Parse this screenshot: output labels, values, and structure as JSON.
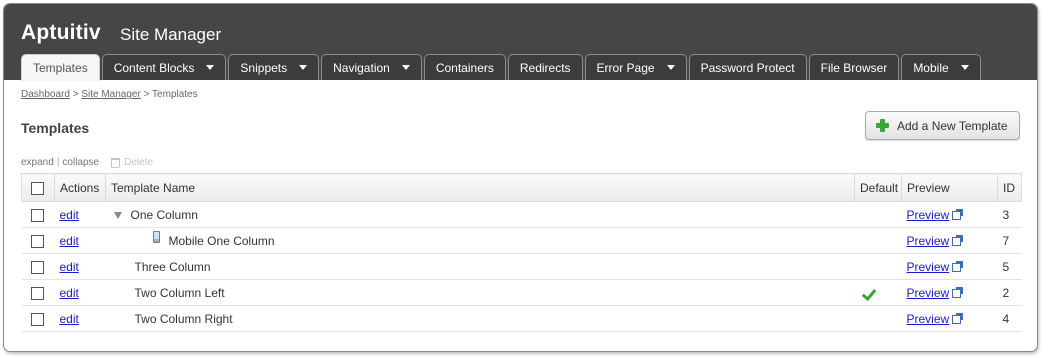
{
  "header": {
    "brand": "Aptuitiv",
    "app_name": "Site Manager"
  },
  "tabs": [
    {
      "label": "Templates",
      "active": true,
      "dropdown": false
    },
    {
      "label": "Content Blocks",
      "active": false,
      "dropdown": true
    },
    {
      "label": "Snippets",
      "active": false,
      "dropdown": true
    },
    {
      "label": "Navigation",
      "active": false,
      "dropdown": true
    },
    {
      "label": "Containers",
      "active": false,
      "dropdown": false
    },
    {
      "label": "Redirects",
      "active": false,
      "dropdown": false
    },
    {
      "label": "Error Page",
      "active": false,
      "dropdown": true
    },
    {
      "label": "Password Protect",
      "active": false,
      "dropdown": false
    },
    {
      "label": "File Browser",
      "active": false,
      "dropdown": false
    },
    {
      "label": "Mobile",
      "active": false,
      "dropdown": true
    }
  ],
  "breadcrumb": {
    "items": [
      "Dashboard",
      "Site Manager",
      "Templates"
    ],
    "separator": ">"
  },
  "page": {
    "title": "Templates",
    "add_button": "Add a New Template"
  },
  "toolbar": {
    "expand": "expand",
    "collapse": "collapse",
    "delete": "Delete"
  },
  "table": {
    "columns": [
      "Actions",
      "Template Name",
      "Default",
      "Preview",
      "ID"
    ],
    "rows": [
      {
        "action": "edit",
        "name": "One Column",
        "default": false,
        "preview": "Preview",
        "id": "3",
        "expanded": true,
        "level": 0,
        "mobile": false
      },
      {
        "action": "edit",
        "name": "Mobile One Column",
        "default": false,
        "preview": "Preview",
        "id": "7",
        "expanded": false,
        "level": 1,
        "mobile": true
      },
      {
        "action": "edit",
        "name": "Three Column",
        "default": false,
        "preview": "Preview",
        "id": "5",
        "expanded": false,
        "level": 0,
        "mobile": false
      },
      {
        "action": "edit",
        "name": "Two Column Left",
        "default": true,
        "preview": "Preview",
        "id": "2",
        "expanded": false,
        "level": 0,
        "mobile": false
      },
      {
        "action": "edit",
        "name": "Two Column Right",
        "default": false,
        "preview": "Preview",
        "id": "4",
        "expanded": false,
        "level": 0,
        "mobile": false
      }
    ]
  },
  "colors": {
    "header_bg": "#464646",
    "link": "#1a1acc",
    "check": "#32a832",
    "plus": "#3aa63a"
  },
  "icons": {
    "tab_dropdown": "caret-down-icon",
    "add": "plus-icon",
    "delete": "trash-icon",
    "expand_row": "triangle-down-icon",
    "mobile_template": "phone-icon",
    "default_mark": "checkmark-icon",
    "preview_external": "external-link-icon"
  }
}
